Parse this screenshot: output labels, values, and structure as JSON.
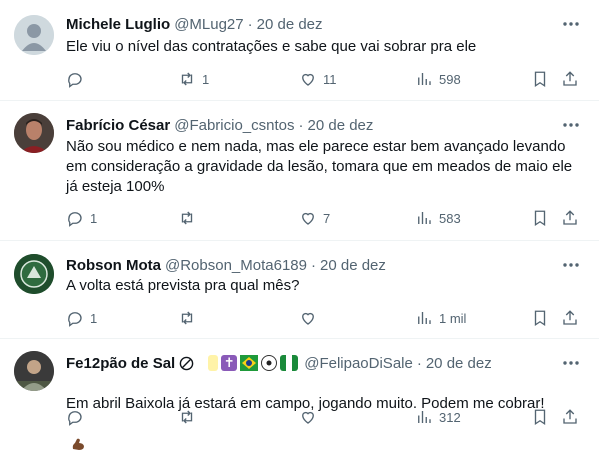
{
  "tweets": [
    {
      "name": "Michele Luglio",
      "handle": "@MLug27",
      "date": "20 de dez",
      "text": "Ele viu o nível das contratações e sabe que vai sobrar pra ele",
      "replies": "",
      "retweets": "1",
      "likes": "11",
      "views": "598"
    },
    {
      "name": "Fabrício César",
      "handle": "@Fabricio_csntos",
      "date": "20 de dez",
      "text": "Não sou médico e nem nada, mas ele parece estar bem avançado levando em consideração a gravidade da lesão, tomara que em meados de maio ele já esteja 100%",
      "replies": "1",
      "retweets": "",
      "likes": "7",
      "views": "583"
    },
    {
      "name": "Robson Mota",
      "handle": "@Robson_Mota6189",
      "date": "20 de dez",
      "text": "A volta está prevista pra qual mês?",
      "replies": "1",
      "retweets": "",
      "likes": "",
      "views": "1 mil"
    },
    {
      "name": "Fe12pão de Sal",
      "handle": "@FelipaoDiSale",
      "date": "20 de dez",
      "text": "Em abril Baixola já estará em campo, jogando muito. Podem me cobrar!",
      "replies": "",
      "retweets": "",
      "likes": "",
      "views": "312"
    }
  ],
  "colors": {
    "secondary_text": "#536471",
    "divider": "#eff3f4"
  },
  "icons": [
    "more-icon",
    "reply-icon",
    "retweet-icon",
    "like-icon",
    "views-icon",
    "bookmark-icon",
    "share-icon"
  ]
}
